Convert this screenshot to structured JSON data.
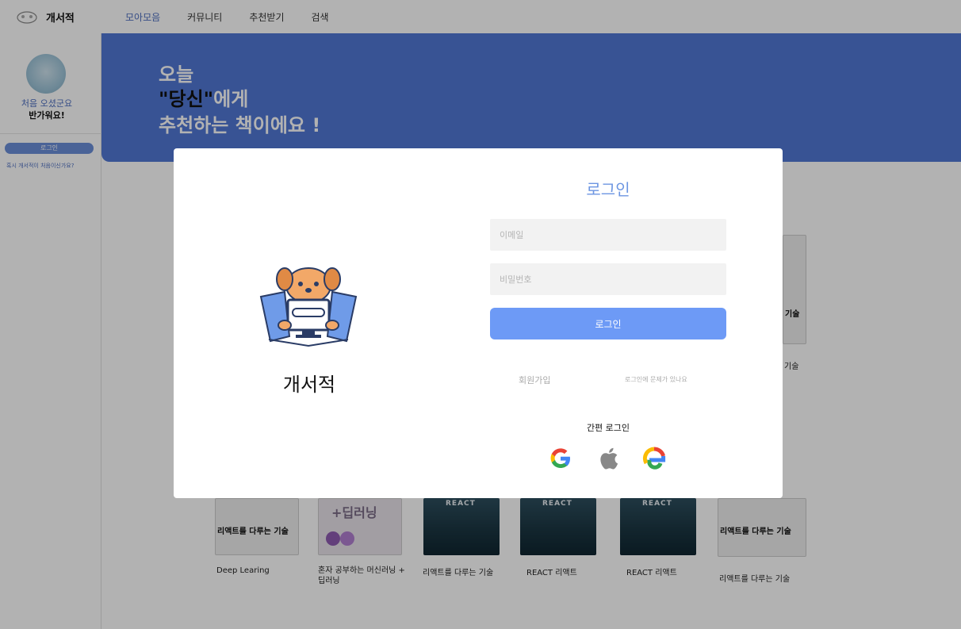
{
  "header": {
    "brand": "개서적",
    "nav": [
      {
        "label": "모아모음",
        "active": true
      },
      {
        "label": "커뮤니티",
        "active": false
      },
      {
        "label": "추천받기",
        "active": false
      },
      {
        "label": "검색",
        "active": false
      }
    ]
  },
  "sidebar": {
    "greeting_line1": "처음 오셨군요",
    "greeting_line2": "반가워요!",
    "login_button": "로그인",
    "hint": "혹시 개서적이 처음이신가요?"
  },
  "banner": {
    "line1": "오늘",
    "line2_highlight": "\"당신\"",
    "line2_rest": "에게",
    "line3": "추천하는 책이에요 !"
  },
  "books": [
    {
      "title": "Deep Learing",
      "cover_text": "리액트를 다루는 기술"
    },
    {
      "title": "혼자 공부하는 머신러닝 + 딥러닝",
      "cover_text": "+딥러닝"
    },
    {
      "title": "리액트를 다루는 기술",
      "cover_text": "REACT"
    },
    {
      "title": "REACT 리액트",
      "cover_text": "REACT"
    },
    {
      "title": "REACT 리액트",
      "cover_text": "REACT"
    },
    {
      "title": "리액트를 다루는 기술",
      "cover_text": "리액트를 다루는 기술"
    },
    {
      "title": "기술",
      "cover_text": "기술"
    }
  ],
  "modal": {
    "brand": "개서적",
    "title": "로그인",
    "email_placeholder": "이메일",
    "password_placeholder": "비밀번호",
    "login_button": "로그인",
    "signup_link": "회원가입",
    "help_link": "로그인에 문제가 있나요",
    "simple_login_label": "간편 로그인",
    "social": [
      "google-icon",
      "apple-icon",
      "edge-icon"
    ]
  },
  "colors": {
    "accent": "#5178d4",
    "button": "#6d9af6",
    "title": "#6d96e2",
    "overlay": "rgba(0,0,0,0.30)"
  }
}
